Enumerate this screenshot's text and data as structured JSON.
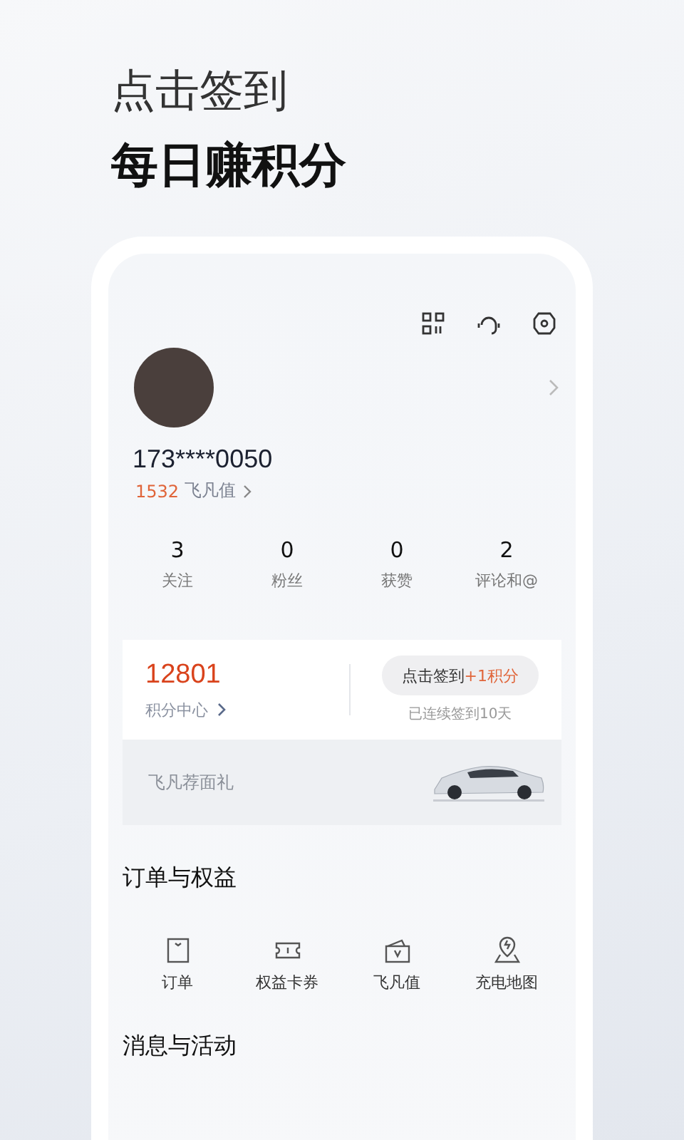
{
  "headline": {
    "subtitle": "点击签到",
    "title": "每日赚积分"
  },
  "profile": {
    "phone": "173****0050",
    "points_value": "1532",
    "points_label": "飞凡值"
  },
  "stats": [
    {
      "value": "3",
      "label": "关注"
    },
    {
      "value": "0",
      "label": "粉丝"
    },
    {
      "value": "0",
      "label": "获赞"
    },
    {
      "value": "2",
      "label": "评论和@"
    }
  ],
  "points_card": {
    "value": "12801",
    "link": "积分中心",
    "signin_label": "点击签到",
    "signin_bonus": "+1积分",
    "streak": "已连续签到10天"
  },
  "banner": {
    "text": "飞凡荐面礼"
  },
  "sections": [
    {
      "title": "订单与权益",
      "items": [
        {
          "kind": "order",
          "label": "订单"
        },
        {
          "kind": "coupon",
          "label": "权益卡券"
        },
        {
          "kind": "wallet",
          "label": "飞凡值"
        },
        {
          "kind": "map",
          "label": "充电地图"
        }
      ]
    },
    {
      "title": "消息与活动"
    }
  ]
}
